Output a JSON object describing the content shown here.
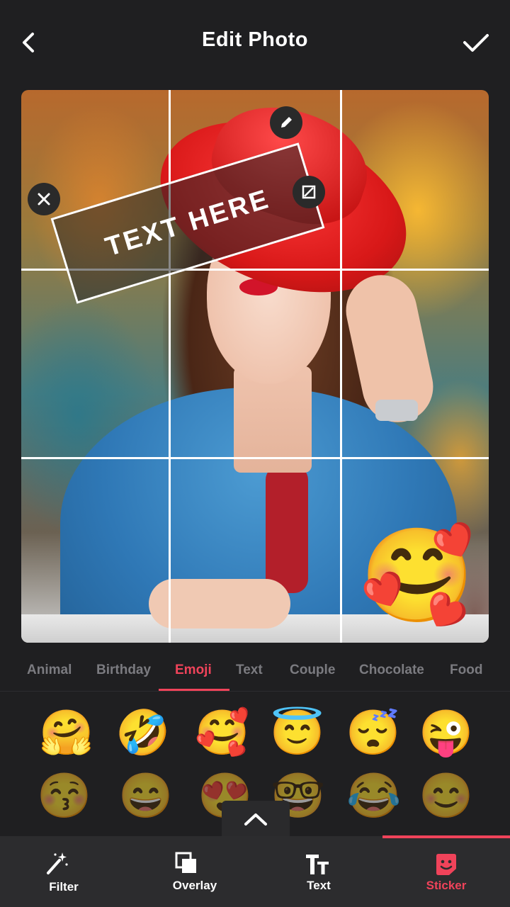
{
  "header": {
    "title": "Edit Photo"
  },
  "sticker_text": "TEXT HERE",
  "photo_emoji": "🥰",
  "tabs": [
    {
      "label": "Animal"
    },
    {
      "label": "Birthday"
    },
    {
      "label": "Emoji"
    },
    {
      "label": "Text"
    },
    {
      "label": "Couple"
    },
    {
      "label": "Chocolate"
    },
    {
      "label": "Food"
    }
  ],
  "active_tab": "Emoji",
  "emojis": {
    "row1": [
      "🤗",
      "🤣",
      "🥰",
      "😇",
      "😴",
      "😜"
    ],
    "row2": [
      "😚",
      "😄",
      "😍",
      "🤓",
      "😂",
      "😊"
    ]
  },
  "bottom_nav": [
    {
      "label": "Filter",
      "icon": "magic-wand-icon"
    },
    {
      "label": "Overlay",
      "icon": "overlay-icon"
    },
    {
      "label": "Text",
      "icon": "text-icon"
    },
    {
      "label": "Sticker",
      "icon": "sticker-icon"
    }
  ],
  "active_nav": "Sticker",
  "colors": {
    "background": "#1f1f21",
    "accent": "#f0435a",
    "nav_bg": "#2c2c2e",
    "inactive_tab": "#7b7b80"
  }
}
